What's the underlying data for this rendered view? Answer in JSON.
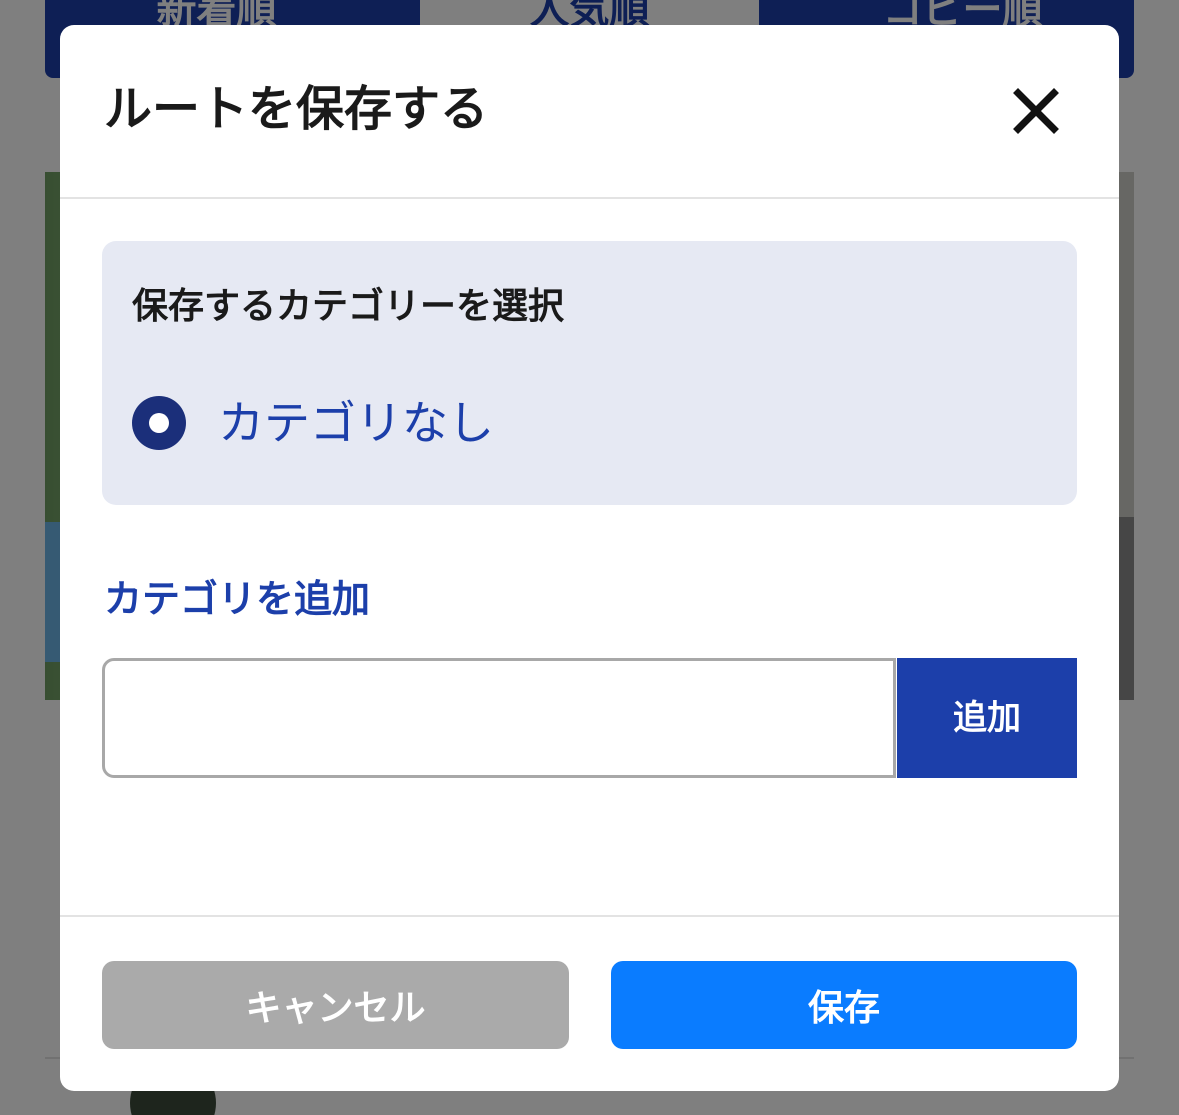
{
  "background": {
    "tabs": [
      "新着順",
      "人気順",
      "コピー順"
    ]
  },
  "modal": {
    "title": "ルートを保存する",
    "close_icon": "close-icon",
    "category_section": {
      "heading": "保存するカテゴリーを選択",
      "options": [
        {
          "label": "カテゴリなし",
          "selected": true
        }
      ]
    },
    "add_category": {
      "label": "カテゴリを追加",
      "input_value": "",
      "input_placeholder": "",
      "button_label": "追加"
    },
    "footer": {
      "cancel_label": "キャンセル",
      "save_label": "保存"
    }
  },
  "colors": {
    "accent": "#1c3faa",
    "radio": "#1b2f7a",
    "save": "#0a7cff",
    "cancel": "#aaaaaa",
    "category_bg": "#e6e9f3"
  }
}
